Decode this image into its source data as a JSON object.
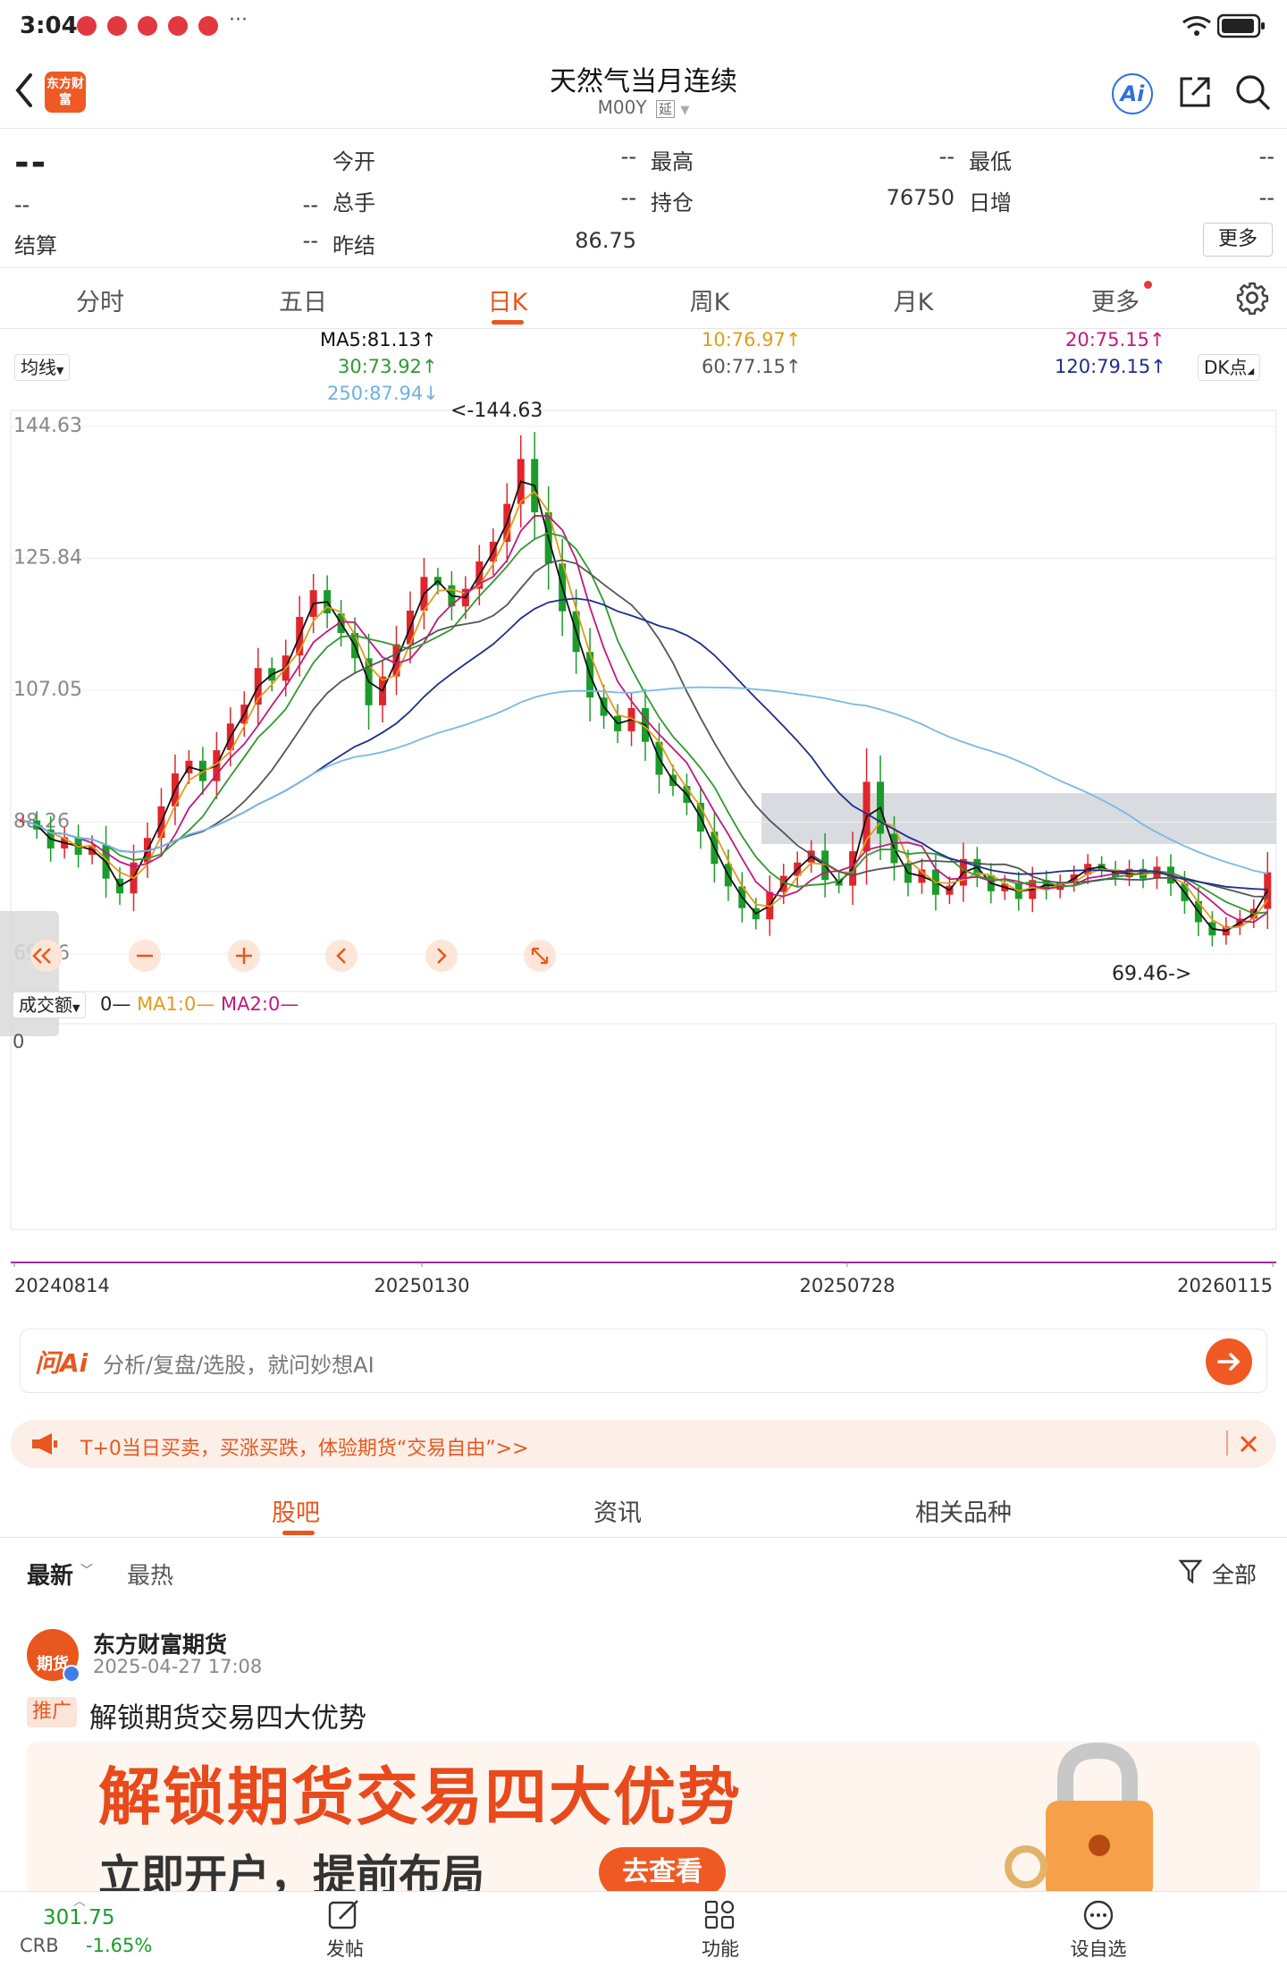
{
  "status": {
    "time": "3:04",
    "extra": "···"
  },
  "header": {
    "title": "天然气当月连续",
    "code": "M00Y",
    "delay_tag": "延"
  },
  "quote": {
    "price": "--",
    "change": "--",
    "change_pct": "--",
    "settle_label": "结算",
    "settle_value": "--",
    "open_label": "今开",
    "open_value": "--",
    "volume_label": "总手",
    "volume_value": "--",
    "prev_settle_label": "昨结",
    "prev_settle_value": "86.75",
    "high_label": "最高",
    "high_value": "--",
    "oi_label": "持仓",
    "oi_value": "76750",
    "low_label": "最低",
    "low_value": "--",
    "daily_inc_label": "日增",
    "daily_inc_value": "--",
    "more_label": "更多"
  },
  "tabs": [
    "分时",
    "五日",
    "日K",
    "周K",
    "月K",
    "更多"
  ],
  "active_tab": "日K",
  "ma_legend": {
    "selector": "均线",
    "ma5": "MA5:81.13↑",
    "ma10": "10:76.97↑",
    "ma20": "20:75.15↑",
    "ma30": "30:73.92↑",
    "ma60": "60:77.15↑",
    "ma120": "120:79.15↑",
    "ma250": "250:87.94↓",
    "dk": "DK点"
  },
  "chart_data": {
    "type": "candlestick",
    "y_ticks": [
      "144.63",
      "125.84",
      "107.05",
      "88.26",
      "69.46"
    ],
    "ylim": [
      69.46,
      144.63
    ],
    "high_label": "<-144.63",
    "low_label": "69.46->",
    "x_ticks": [
      "20240814",
      "20250130",
      "20250728",
      "20260115"
    ],
    "colors": {
      "up": "#e0262c",
      "down": "#1a9c2a",
      "ma5": "#111111",
      "ma10": "#e39b1a",
      "ma20": "#c2187f",
      "ma30": "#2f9a2f",
      "ma60": "#555555",
      "ma120": "#1f2e8c",
      "ma250": "#7ab8e6"
    },
    "series": [
      {
        "name": "K",
        "values": [
          88.5,
          87.2,
          84.5,
          86.1,
          83.6,
          85.0,
          80.2,
          78.1,
          82.5,
          86.0,
          90.5,
          95.2,
          97.0,
          94.1,
          98.5,
          102.3,
          105.0,
          110.2,
          108.4,
          112.0,
          117.5,
          121.3,
          118.0,
          115.2,
          111.6,
          104.9,
          109.0,
          113.6,
          118.4,
          123.2,
          122.0,
          119.0,
          121.5,
          125.4,
          128.2,
          133.6,
          140.0,
          132.4,
          125.1,
          118.3,
          112.5,
          106.0,
          103.4,
          101.2,
          104.5,
          99.7,
          95.0,
          93.4,
          91.0,
          86.9,
          82.3,
          79.1,
          76.0,
          74.4,
          78.3,
          80.6,
          82.5,
          84.2,
          80.0,
          79.2,
          84.1,
          94.0,
          86.6,
          82.4,
          79.6,
          81.5,
          77.9,
          79.2,
          83.0,
          80.7,
          78.4,
          79.5,
          77.3,
          80.0,
          78.6,
          79.6,
          80.8,
          82.3,
          81.5,
          80.4,
          81.6,
          80.2,
          81.9,
          79.5,
          77.0,
          74.0,
          72.1,
          73.4,
          74.5,
          75.9,
          81.1
        ]
      }
    ],
    "volume": {
      "label": "成交额",
      "value": "0",
      "ma1": "MA1:0",
      "ma2": "MA2:0"
    }
  },
  "ai_bar": {
    "logo": "问Ai",
    "placeholder": "分析/复盘/选股，就问妙想AI"
  },
  "promo": {
    "text": "T+0当日买卖，买涨买跌，体验期货“交易自由”>>"
  },
  "content_tabs": [
    "股吧",
    "资讯",
    "相关品种"
  ],
  "active_content_tab": "股吧",
  "filters": {
    "latest": "最新",
    "hot": "最热",
    "all": "全部"
  },
  "post": {
    "author": "东方财富期货",
    "avatar_text": "期货",
    "time": "2025-04-27 17:08",
    "tag": "推广",
    "title": "解锁期货交易四大优势",
    "banner_text": "解锁期货交易四大优势",
    "banner_sub": "立即开户，提前布局",
    "banner_btn": "去查看"
  },
  "bottom": {
    "index_value": "301.75",
    "index_name": "CRB",
    "index_change": "-1.65%",
    "post_label": "发帖",
    "func_label": "功能",
    "watch_label": "设自选"
  },
  "app_logo": "东方财富"
}
